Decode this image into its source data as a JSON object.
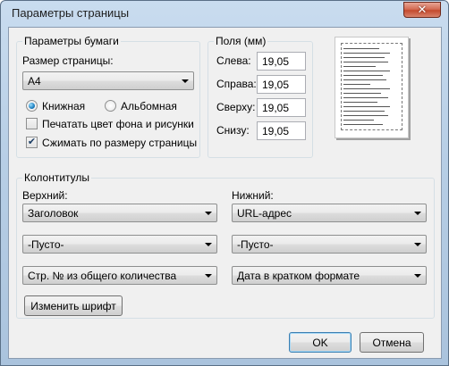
{
  "window": {
    "title": "Параметры страницы",
    "close_label": "✕"
  },
  "paper": {
    "group_label": "Параметры бумаги",
    "size_label": "Размер страницы:",
    "size_value": "A4",
    "portrait_label": "Книжная",
    "landscape_label": "Альбомная",
    "orientation_selected": "portrait",
    "print_bg_label": "Печатать цвет фона и рисунки",
    "print_bg_checked": false,
    "shrink_label": "Сжимать по размеру страницы",
    "shrink_checked": true
  },
  "margins": {
    "group_label": "Поля (мм)",
    "left_label": "Слева:",
    "left_value": "19,05",
    "right_label": "Справа:",
    "right_value": "19,05",
    "top_label": "Сверху:",
    "top_value": "19,05",
    "bottom_label": "Снизу:",
    "bottom_value": "19,05"
  },
  "headers": {
    "group_label": "Колонтитулы",
    "header_label": "Верхний:",
    "footer_label": "Нижний:",
    "header_1": "Заголовок",
    "header_2": "-Пусто-",
    "header_3": "Стр. № из общего количества",
    "footer_1": "URL-адрес",
    "footer_2": "-Пусто-",
    "footer_3": "Дата в кратком формате",
    "font_button": "Изменить шрифт"
  },
  "buttons": {
    "ok": "OK",
    "cancel": "Отмена"
  }
}
